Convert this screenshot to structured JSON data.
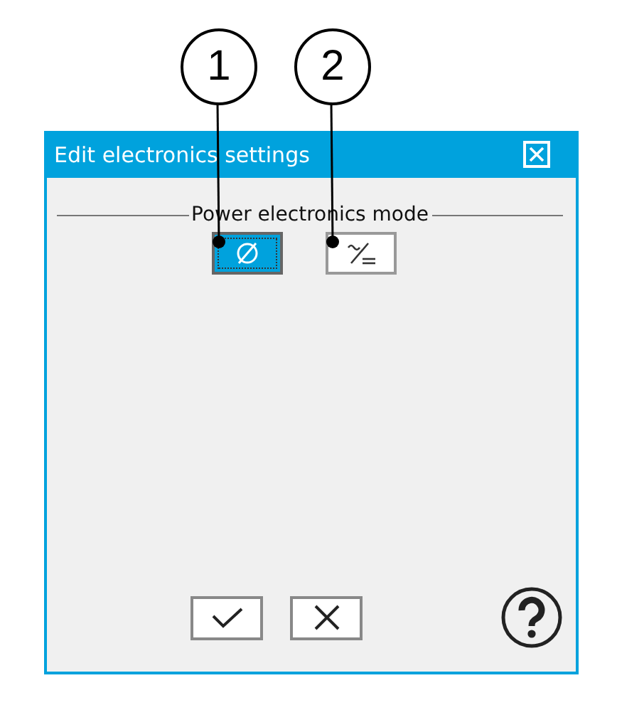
{
  "callouts": [
    {
      "number": "1"
    },
    {
      "number": "2"
    }
  ],
  "window": {
    "title": "Edit electronics settings"
  },
  "mode_group": {
    "label": "Power electronics mode",
    "options": [
      {
        "kind": "none",
        "selected": true
      },
      {
        "kind": "acdc",
        "selected": false
      }
    ]
  },
  "buttons": [
    {
      "kind": "ok"
    },
    {
      "kind": "cancel"
    }
  ]
}
